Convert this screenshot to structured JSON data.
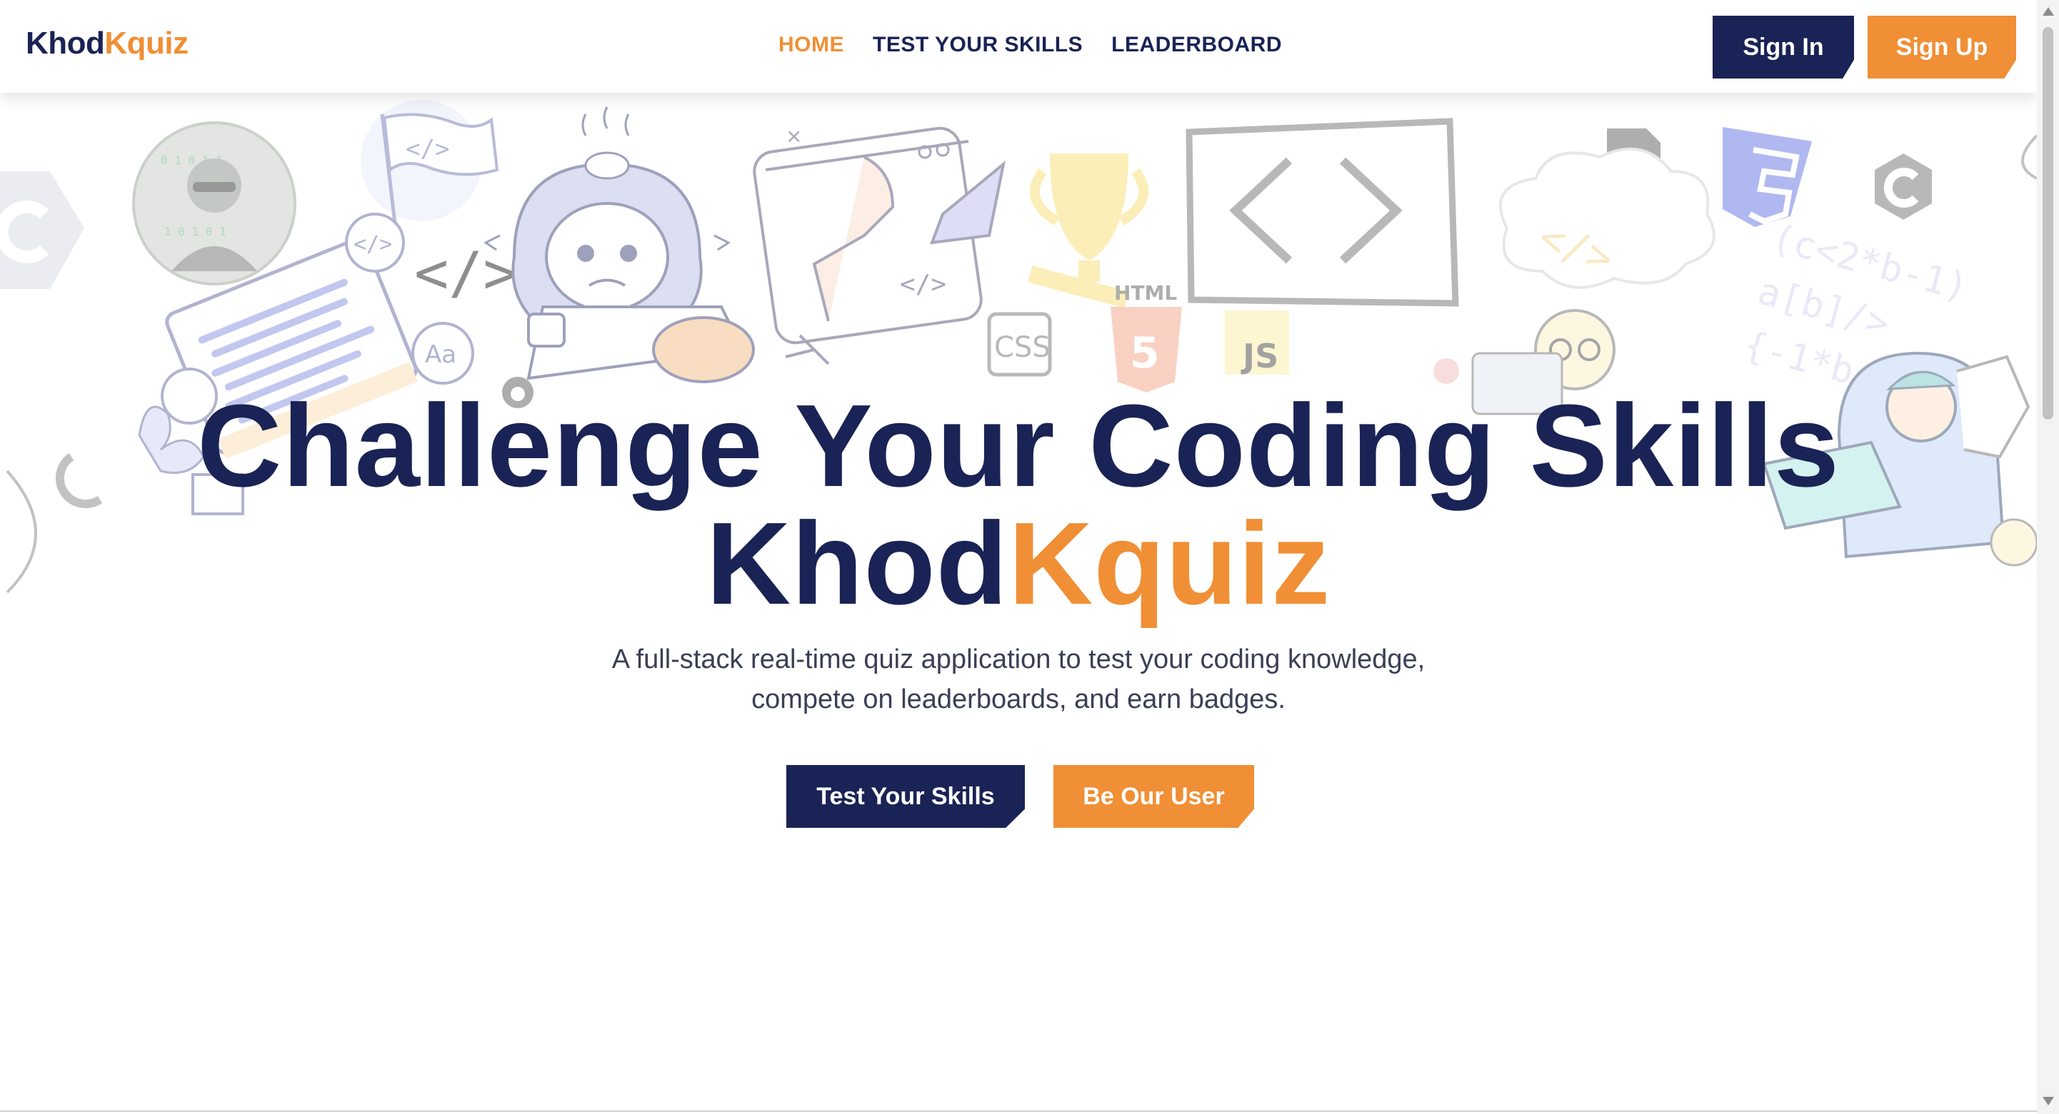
{
  "header": {
    "logo_part1": "Khod",
    "logo_part2": "Kquiz",
    "nav": [
      {
        "label": "HOME",
        "active": true
      },
      {
        "label": "TEST YOUR SKILLS",
        "active": false
      },
      {
        "label": "LEADERBOARD",
        "active": false
      }
    ],
    "sign_in_label": "Sign In",
    "sign_up_label": "Sign Up"
  },
  "decorations": {
    "badge_html": "HTML",
    "badge_css": "CSS",
    "badge_js": "JS",
    "file_js": "JS",
    "code_tag": "</>",
    "font_sample": "Aa"
  },
  "hero": {
    "title_line1": "Challenge Your Coding Skills",
    "title_part1": "Khod",
    "title_part2": "Kquiz",
    "subtitle_line1": "A full-stack real-time quiz application to test your coding knowledge,",
    "subtitle_line2": "compete on leaderboards, and earn badges.",
    "cta_primary": "Test Your Skills",
    "cta_secondary": "Be Our User"
  },
  "colors": {
    "navy": "#1a2355",
    "orange": "#f08f35"
  }
}
